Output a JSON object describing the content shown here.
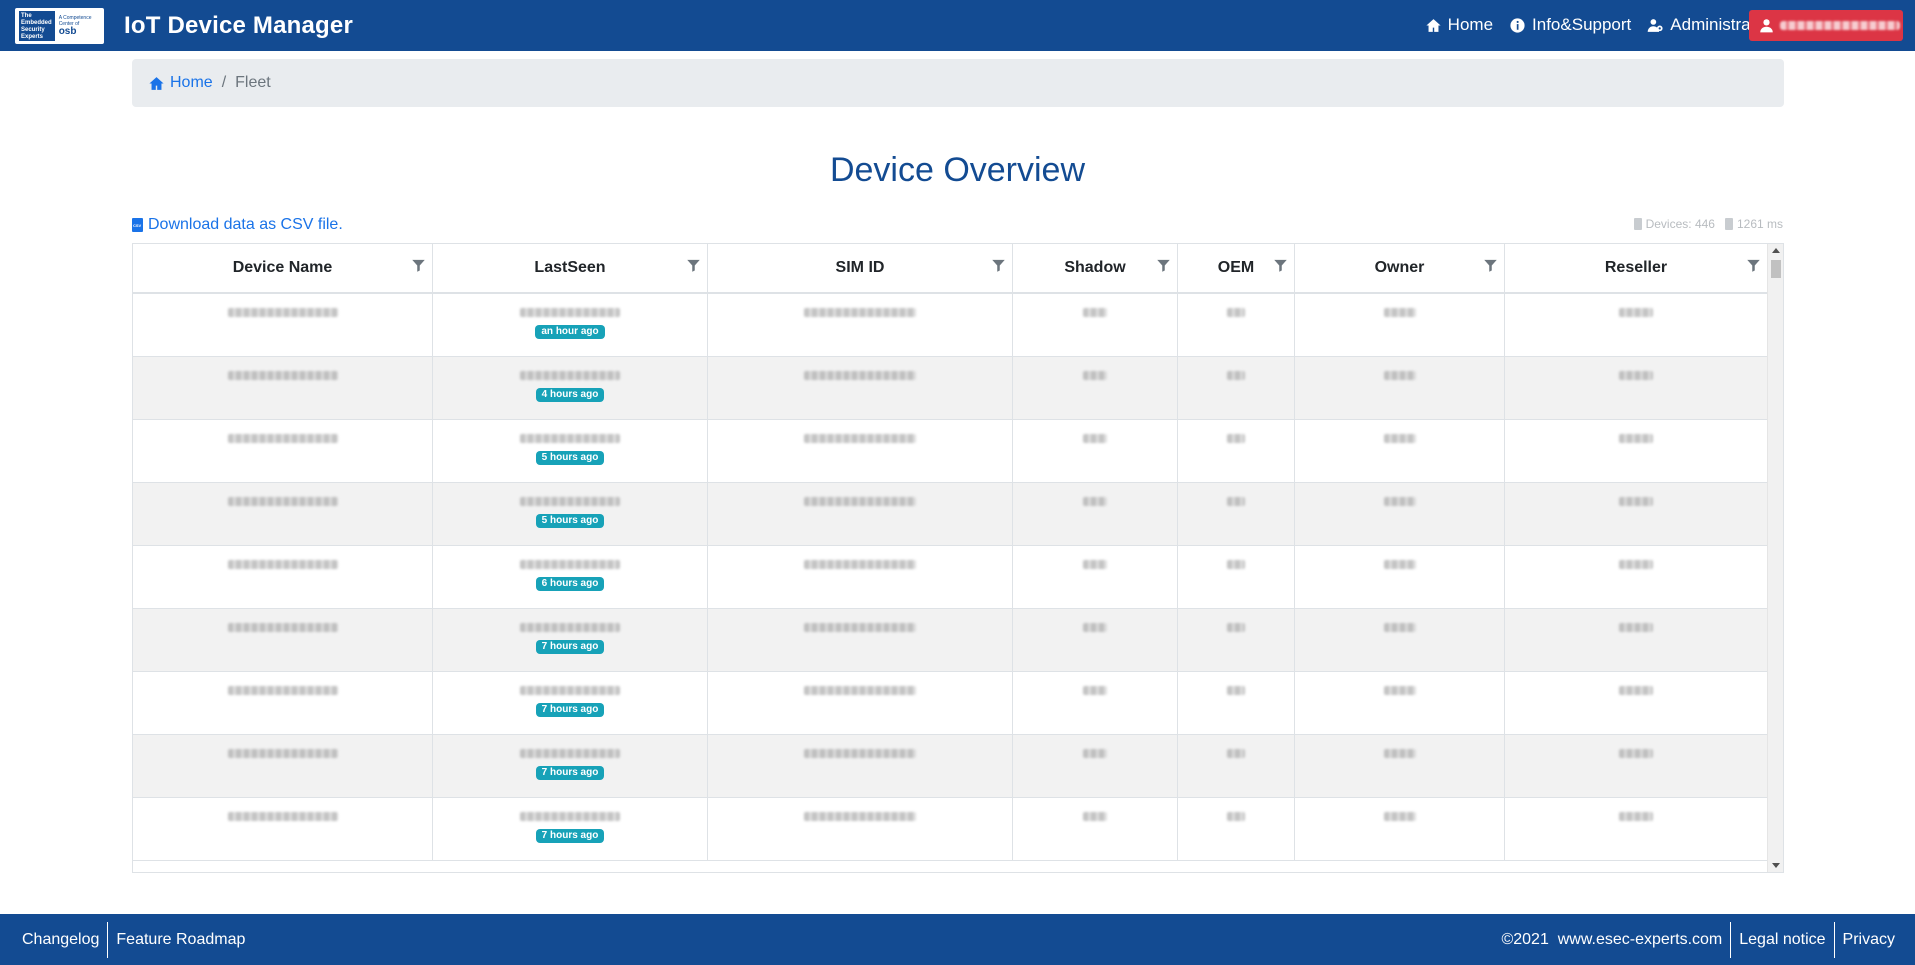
{
  "header": {
    "app_title": "IoT Device Manager",
    "logo_text": "The Embedded Security Experts",
    "logo_side": "A Competence Center of",
    "logo_brand": "osb",
    "nav": [
      {
        "label": "Home",
        "icon": "home-icon"
      },
      {
        "label": "Info&Support",
        "icon": "info-icon"
      },
      {
        "label": "Administration",
        "icon": "users-cog-icon"
      }
    ],
    "user_button_color": "#dc3545"
  },
  "breadcrumb": {
    "home": "Home",
    "separator": "/",
    "current": "Fleet"
  },
  "main": {
    "title": "Device Overview",
    "csv_link": "Download data as CSV file.",
    "device_count": "Devices: 446",
    "load_time": "1261 ms"
  },
  "table": {
    "columns": [
      "Device Name",
      "LastSeen",
      "SIM ID",
      "Shadow",
      "OEM",
      "Owner",
      "Reseller"
    ],
    "rows": [
      {
        "last_seen_badge": "an hour ago"
      },
      {
        "last_seen_badge": "4 hours ago"
      },
      {
        "last_seen_badge": "5 hours ago"
      },
      {
        "last_seen_badge": "5 hours ago"
      },
      {
        "last_seen_badge": "6 hours ago"
      },
      {
        "last_seen_badge": "7 hours ago"
      },
      {
        "last_seen_badge": "7 hours ago"
      },
      {
        "last_seen_badge": "7 hours ago"
      },
      {
        "last_seen_badge": "7 hours ago"
      }
    ]
  },
  "footer": {
    "left": [
      "Changelog",
      "Feature Roadmap"
    ],
    "copyright": "©2021",
    "site": "www.esec-experts.com",
    "legal": "Legal notice",
    "privacy": "Privacy"
  },
  "colors": {
    "primary": "#134b92",
    "link": "#1a73e8",
    "badge": "#17a2b8",
    "danger": "#dc3545"
  }
}
